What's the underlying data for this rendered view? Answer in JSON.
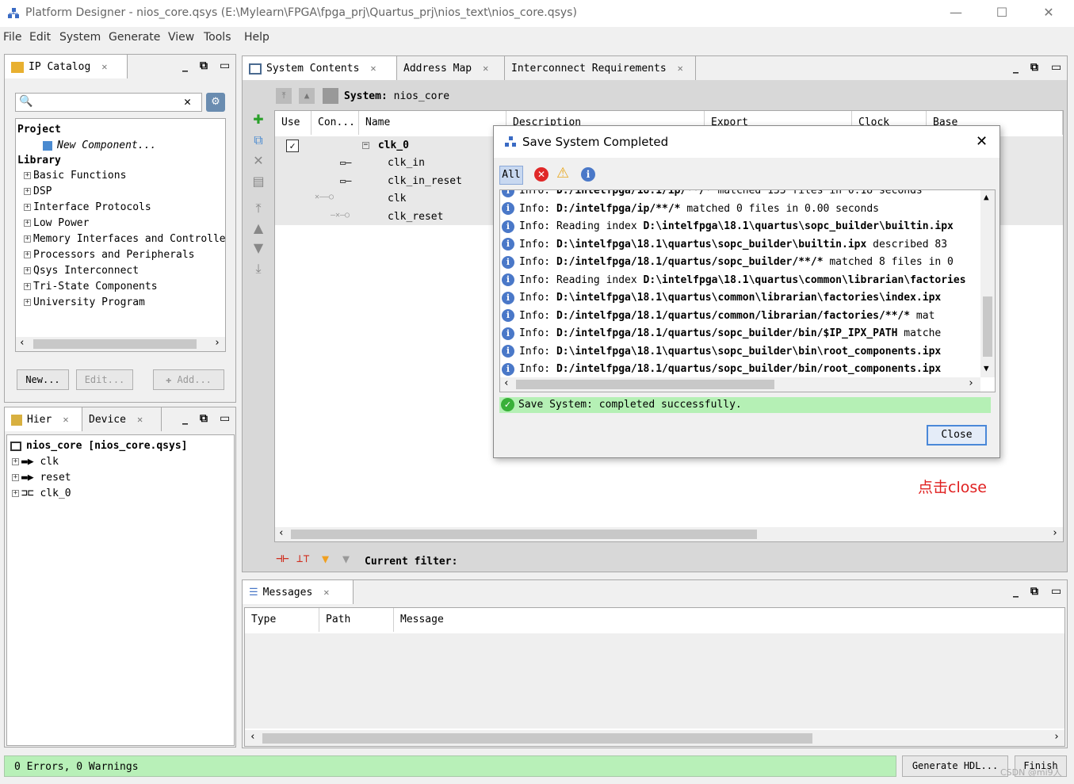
{
  "window": {
    "title": "Platform Designer - nios_core.qsys (E:\\Mylearn\\FPGA\\fpga_prj\\Quartus_prj\\nios_text\\nios_core.qsys)",
    "minimize": "—",
    "maximize": "☐",
    "close": "✕"
  },
  "menu": [
    "File",
    "Edit",
    "System",
    "Generate",
    "View",
    "Tools",
    "Help"
  ],
  "ip_catalog": {
    "tab_label": "IP Catalog",
    "search_value": "",
    "project_label": "Project",
    "new_component": "New Component...",
    "library_label": "Library",
    "library_items": [
      "Basic Functions",
      "DSP",
      "Interface Protocols",
      "Low Power",
      "Memory Interfaces and Controllers",
      "Processors and Peripherals",
      "Qsys Interconnect",
      "Tri-State Components",
      "University Program"
    ],
    "new_button": "New...",
    "edit_button": "Edit...",
    "add_button": "Add..."
  },
  "hierarchy": {
    "tab_label": "Hier",
    "device_tab": "Device",
    "root": "nios_core [nios_core.qsys]",
    "items": [
      "clk",
      "reset",
      "clk_0"
    ]
  },
  "system_contents": {
    "tabs": [
      "System Contents",
      "Address Map",
      "Interconnect Requirements"
    ],
    "system_label": "System:",
    "system_name": "nios_core",
    "columns": [
      "Use",
      "Con...",
      "Name",
      "Description",
      "Export",
      "Clock",
      "Base"
    ],
    "component": "clk_0",
    "ports": [
      "clk_in",
      "clk_in_reset",
      "clk",
      "clk_reset"
    ],
    "current_filter_label": "Current filter:"
  },
  "messages": {
    "tab_label": "Messages",
    "columns": [
      "Type",
      "Path",
      "Message"
    ]
  },
  "status": {
    "text": "0 Errors, 0 Warnings",
    "generate_button": "Generate HDL...",
    "finish_button": "Finish"
  },
  "dialog": {
    "title": "Save System Completed",
    "filter_all": "All",
    "log": [
      {
        "prefix": "Info: ",
        "bold": "D:/intelfpga/18.1/ip/**/*",
        "rest": " matched 133 files in 0.18 seconds"
      },
      {
        "prefix": "Info: ",
        "bold": "D:/intelfpga/ip/**/*",
        "rest": " matched 0 files in 0.00 seconds"
      },
      {
        "prefix": "Info: Reading index ",
        "bold": "D:\\intelfpga\\18.1\\quartus\\sopc_builder\\builtin.ipx",
        "rest": ""
      },
      {
        "prefix": "Info: ",
        "bold": "D:\\intelfpga\\18.1\\quartus\\sopc_builder\\builtin.ipx",
        "rest": " described 83"
      },
      {
        "prefix": "Info: ",
        "bold": "D:/intelfpga/18.1/quartus/sopc_builder/**/*",
        "rest": " matched 8 files in 0"
      },
      {
        "prefix": "Info: Reading index ",
        "bold": "D:\\intelfpga\\18.1\\quartus\\common\\librarian\\factories",
        "rest": ""
      },
      {
        "prefix": "Info: ",
        "bold": "D:\\intelfpga\\18.1\\quartus\\common\\librarian\\factories\\index.ipx",
        "rest": ""
      },
      {
        "prefix": "Info: ",
        "bold": "D:/intelfpga/18.1/quartus/common/librarian/factories/**/*",
        "rest": " mat"
      },
      {
        "prefix": "Info: ",
        "bold": "D:/intelfpga/18.1/quartus/sopc_builder/bin/$IP_IPX_PATH",
        "rest": " matche"
      },
      {
        "prefix": "Info: ",
        "bold": "D:\\intelfpga\\18.1\\quartus\\sopc_builder\\bin\\root_components.ipx",
        "rest": ""
      },
      {
        "prefix": "Info: ",
        "bold": "D:/intelfpga/18.1/quartus/sopc_builder/bin/root_components.ipx",
        "rest": ""
      }
    ],
    "success": "Save System: completed successfully.",
    "close_button": "Close",
    "close_icon": "✕"
  },
  "annotation": "点击close",
  "watermark": "CSDN @mi9人",
  "colors": {
    "success_bg": "#b5f0b5",
    "status_bg": "#b8f0b8",
    "annotation": "#e02020",
    "info_blue": "#4a78c8"
  }
}
